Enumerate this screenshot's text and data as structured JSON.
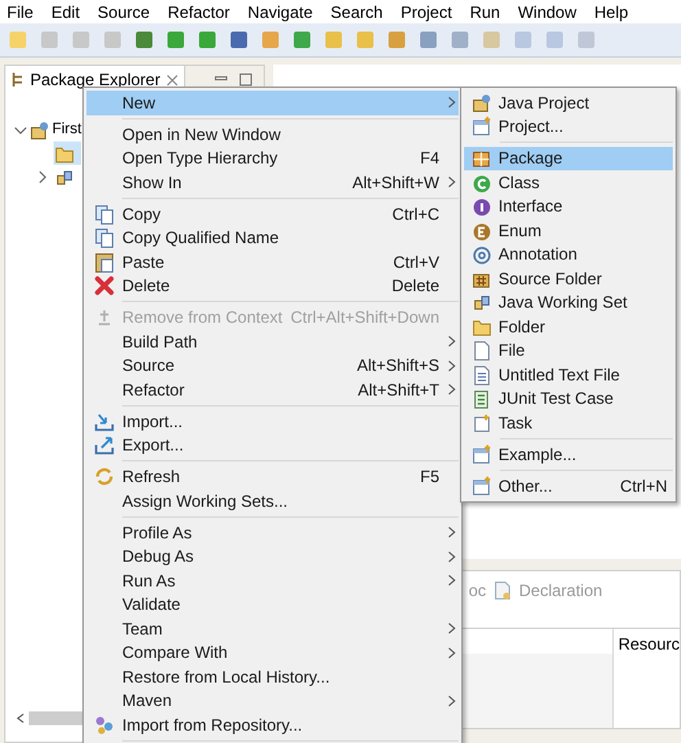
{
  "menu_bar": [
    "File",
    "Edit",
    "Source",
    "Refactor",
    "Navigate",
    "Search",
    "Project",
    "Run",
    "Window",
    "Help"
  ],
  "package_explorer": {
    "title": "Package Explorer",
    "tree": [
      {
        "label": "First",
        "expanded": true,
        "children": [
          {
            "selected": true
          },
          {
            "selected": false,
            "expanded": false
          }
        ]
      }
    ]
  },
  "bottom_panel": {
    "tabs": [
      {
        "label": "oc"
      },
      {
        "label": "Declaration"
      }
    ],
    "columns": [
      "Resourc"
    ]
  },
  "context_menu": [
    {
      "kind": "item",
      "label": "New",
      "submenu": true,
      "selected": true
    },
    {
      "kind": "separator"
    },
    {
      "kind": "item",
      "label": "Open in New Window"
    },
    {
      "kind": "item",
      "label": "Open Type Hierarchy",
      "shortcut": "F4"
    },
    {
      "kind": "item",
      "label": "Show In",
      "shortcut": "Alt+Shift+W",
      "submenu": true
    },
    {
      "kind": "separator"
    },
    {
      "kind": "item",
      "label": "Copy",
      "shortcut": "Ctrl+C"
    },
    {
      "kind": "item",
      "label": "Copy Qualified Name"
    },
    {
      "kind": "item",
      "label": "Paste",
      "shortcut": "Ctrl+V"
    },
    {
      "kind": "item",
      "label": "Delete",
      "shortcut": "Delete"
    },
    {
      "kind": "separator"
    },
    {
      "kind": "item",
      "label": "Remove from Context",
      "shortcut": "Ctrl+Alt+Shift+Down",
      "disabled": true
    },
    {
      "kind": "item",
      "label": "Build Path",
      "submenu": true
    },
    {
      "kind": "item",
      "label": "Source",
      "shortcut": "Alt+Shift+S",
      "submenu": true
    },
    {
      "kind": "item",
      "label": "Refactor",
      "shortcut": "Alt+Shift+T",
      "submenu": true
    },
    {
      "kind": "separator"
    },
    {
      "kind": "item",
      "label": "Import..."
    },
    {
      "kind": "item",
      "label": "Export..."
    },
    {
      "kind": "separator"
    },
    {
      "kind": "item",
      "label": "Refresh",
      "shortcut": "F5"
    },
    {
      "kind": "item",
      "label": "Assign Working Sets..."
    },
    {
      "kind": "separator"
    },
    {
      "kind": "item",
      "label": "Profile As",
      "submenu": true
    },
    {
      "kind": "item",
      "label": "Debug As",
      "submenu": true
    },
    {
      "kind": "item",
      "label": "Run As",
      "submenu": true
    },
    {
      "kind": "item",
      "label": "Validate"
    },
    {
      "kind": "item",
      "label": "Team",
      "submenu": true
    },
    {
      "kind": "item",
      "label": "Compare With",
      "submenu": true
    },
    {
      "kind": "item",
      "label": "Restore from Local History..."
    },
    {
      "kind": "item",
      "label": "Maven",
      "submenu": true
    },
    {
      "kind": "item",
      "label": "Import from Repository..."
    },
    {
      "kind": "separator"
    }
  ],
  "new_submenu": [
    {
      "kind": "item",
      "label": "Java Project",
      "selected": false
    },
    {
      "kind": "item",
      "label": "Project...",
      "selected": false
    },
    {
      "kind": "separator"
    },
    {
      "kind": "item",
      "label": "Package",
      "selected": true
    },
    {
      "kind": "item",
      "label": "Class",
      "selected": false
    },
    {
      "kind": "item",
      "label": "Interface",
      "selected": false
    },
    {
      "kind": "item",
      "label": "Enum",
      "selected": false
    },
    {
      "kind": "item",
      "label": "Annotation",
      "selected": false
    },
    {
      "kind": "item",
      "label": "Source Folder",
      "selected": false
    },
    {
      "kind": "item",
      "label": "Java Working Set",
      "selected": false
    },
    {
      "kind": "item",
      "label": "Folder",
      "selected": false
    },
    {
      "kind": "item",
      "label": "File",
      "selected": false
    },
    {
      "kind": "item",
      "label": "Untitled Text File",
      "selected": false
    },
    {
      "kind": "item",
      "label": "JUnit Test Case",
      "selected": false
    },
    {
      "kind": "item",
      "label": "Task",
      "selected": false
    },
    {
      "kind": "separator"
    },
    {
      "kind": "item",
      "label": "Example...",
      "selected": false
    },
    {
      "kind": "separator"
    },
    {
      "kind": "item",
      "label": "Other...",
      "shortcut": "Ctrl+N",
      "selected": false
    }
  ]
}
